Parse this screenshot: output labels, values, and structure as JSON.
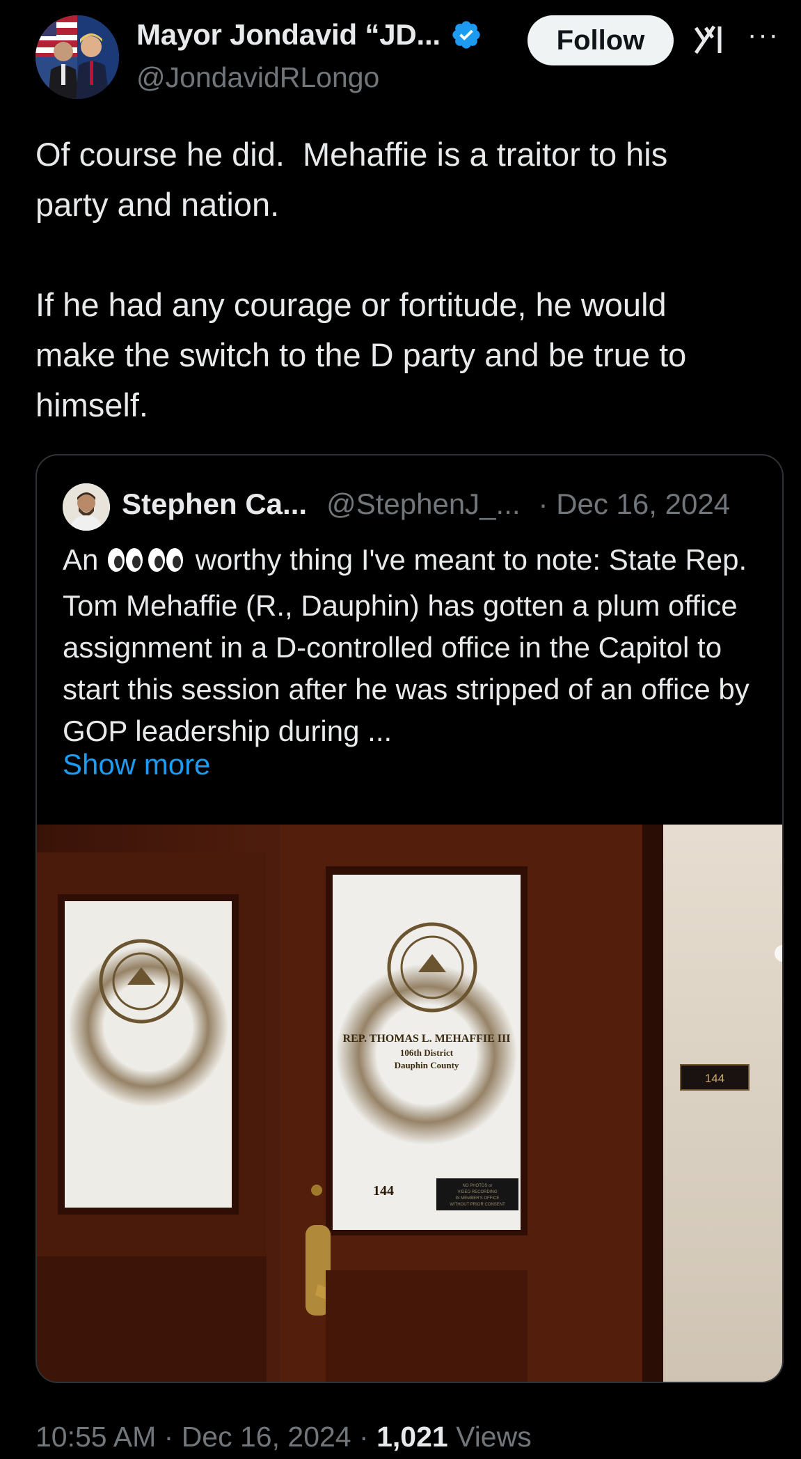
{
  "author": {
    "display_name": "Mayor Jondavid “JD...",
    "handle": "@JondavidRLongo",
    "avatar_icon": "profile-photo",
    "verified_icon": "verified-badge-icon",
    "verified_color": "#1d9bf0"
  },
  "actions": {
    "follow_label": "Follow",
    "grok_icon": "grok-icon",
    "more_icon": "more-options-icon",
    "more_glyph": "···"
  },
  "tweet": {
    "text": "Of course he did.  Mehaffie is a traitor to his\nparty and nation.\n\nIf he had any courage or fortitude, he would\nmake the switch to the D party and be true to\nhimself."
  },
  "quote": {
    "display_name": "Stephen Ca...",
    "handle": "@StephenJ_...",
    "date": "· Dec 16, 2024",
    "text_before_emoji": "An ",
    "emoji": "eyes-emoji",
    "text_after_emoji": " worthy thing I've meant to note: State Rep. Tom Mehaffie (R., Dauphin) has gotten a plum office assignment in a D-controlled office in the Capitol to start this session after he was stripped of an office by GOP leadership during ...",
    "show_more_label": "Show more",
    "link_color": "#1d9bf0",
    "image": {
      "nameplate_line1": "REP. THOMAS L. MEHAFFIE III",
      "nameplate_line2": "106th District",
      "nameplate_line3": "Dauphin County",
      "door_number": "144",
      "wall_number": "144",
      "notice_line1": "NO PHOTOS or",
      "notice_line2": "VIDEO RECORDING",
      "notice_line3": "IN MEMBER'S OFFICE",
      "notice_line4": "WITHOUT PRIOR CONSENT"
    }
  },
  "meta": {
    "time": "10:55 AM",
    "date": "Dec 16, 2024",
    "separator": "·",
    "views_count": "1,021",
    "views_label": "Views"
  }
}
